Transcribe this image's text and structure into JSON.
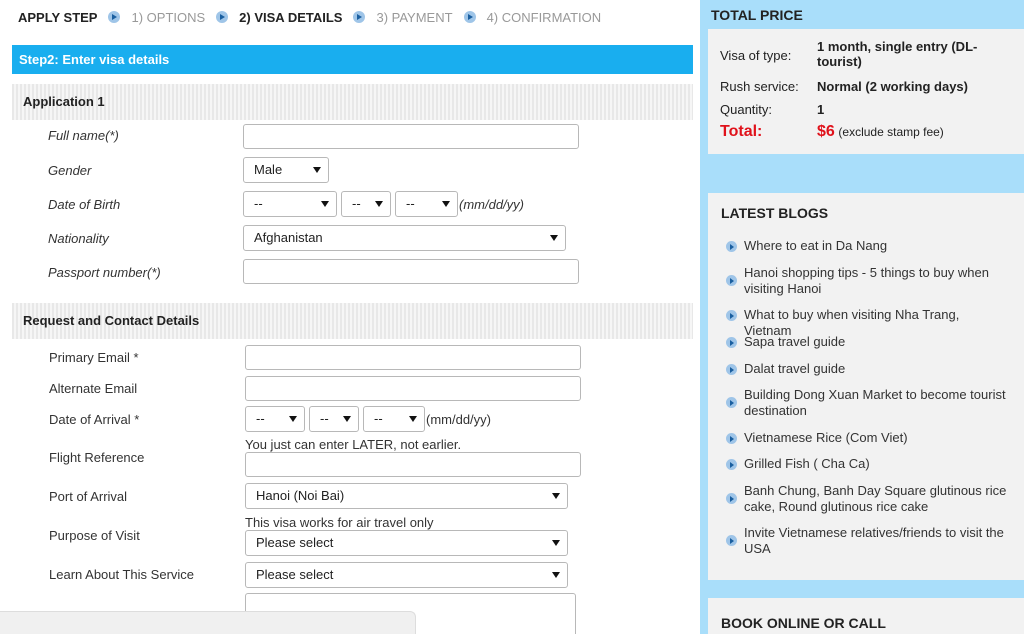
{
  "steps": {
    "lead": "APPLY STEP",
    "items": [
      {
        "label": "1) OPTIONS",
        "active": false
      },
      {
        "label": "2) VISA DETAILS",
        "active": true
      },
      {
        "label": "3) PAYMENT",
        "active": false
      },
      {
        "label": "4) CONFIRMATION",
        "active": false
      }
    ]
  },
  "form": {
    "banner": "Step2: Enter visa details",
    "application_head": "Application 1",
    "full_name_label": "Full name(*)",
    "gender_label": "Gender",
    "gender_value": "Male",
    "dob_label": "Date of Birth",
    "dob_day": "--",
    "dob_month": "--",
    "dob_year": "--",
    "dob_hint": "(mm/dd/yy)",
    "nationality_label": "Nationality",
    "nationality_value": "Afghanistan",
    "passport_label": "Passport number(*)",
    "contact_head": "Request and Contact Details",
    "primary_email_label": "Primary Email *",
    "alternate_email_label": "Alternate Email",
    "arrival_label": "Date of Arrival *",
    "arrival_m": "--",
    "arrival_d": "--",
    "arrival_y": "--",
    "arrival_hint": "(mm/dd/yy)",
    "arrival_note": "You just can enter LATER, not earlier.",
    "flight_label": "Flight Reference",
    "port_label": "Port of Arrival",
    "port_value": "Hanoi (Noi Bai)",
    "port_note": "This visa works for air travel only",
    "purpose_label": "Purpose of Visit",
    "purpose_value": "Please select",
    "learn_label": "Learn About This Service",
    "learn_value": "Please select"
  },
  "price": {
    "title": "TOTAL PRICE",
    "type_label": "Visa of type:",
    "type_value": "1 month, single entry (DL-tourist)",
    "rush_label": "Rush service:",
    "rush_value": "Normal (2 working days)",
    "qty_label": "Quantity:",
    "qty_value": "1",
    "total_label": "Total:",
    "total_value": "$6",
    "total_note": "(exclude stamp fee)"
  },
  "blogs": {
    "title": "LATEST BLOGS",
    "items": [
      "Where to eat in Da Nang",
      "Hanoi shopping tips - 5 things to buy when visiting Hanoi",
      "What to buy when visiting Nha Trang, Vietnam",
      "Sapa travel guide",
      "Dalat travel guide",
      "Building Dong Xuan Market to become tourist destination",
      "Vietnamese Rice (Com Viet)",
      "Grilled Fish ( Cha Ca)",
      "Banh Chung, Banh Day Square glutinous rice cake, Round glutinous rice cake",
      "Invite Vietnamese relatives/friends to visit the USA"
    ]
  },
  "book": {
    "title": "BOOK ONLINE OR CALL"
  },
  "colors": {
    "banner": "#19aeef",
    "sidebar": "#a9defa",
    "total": "#e0121b"
  }
}
